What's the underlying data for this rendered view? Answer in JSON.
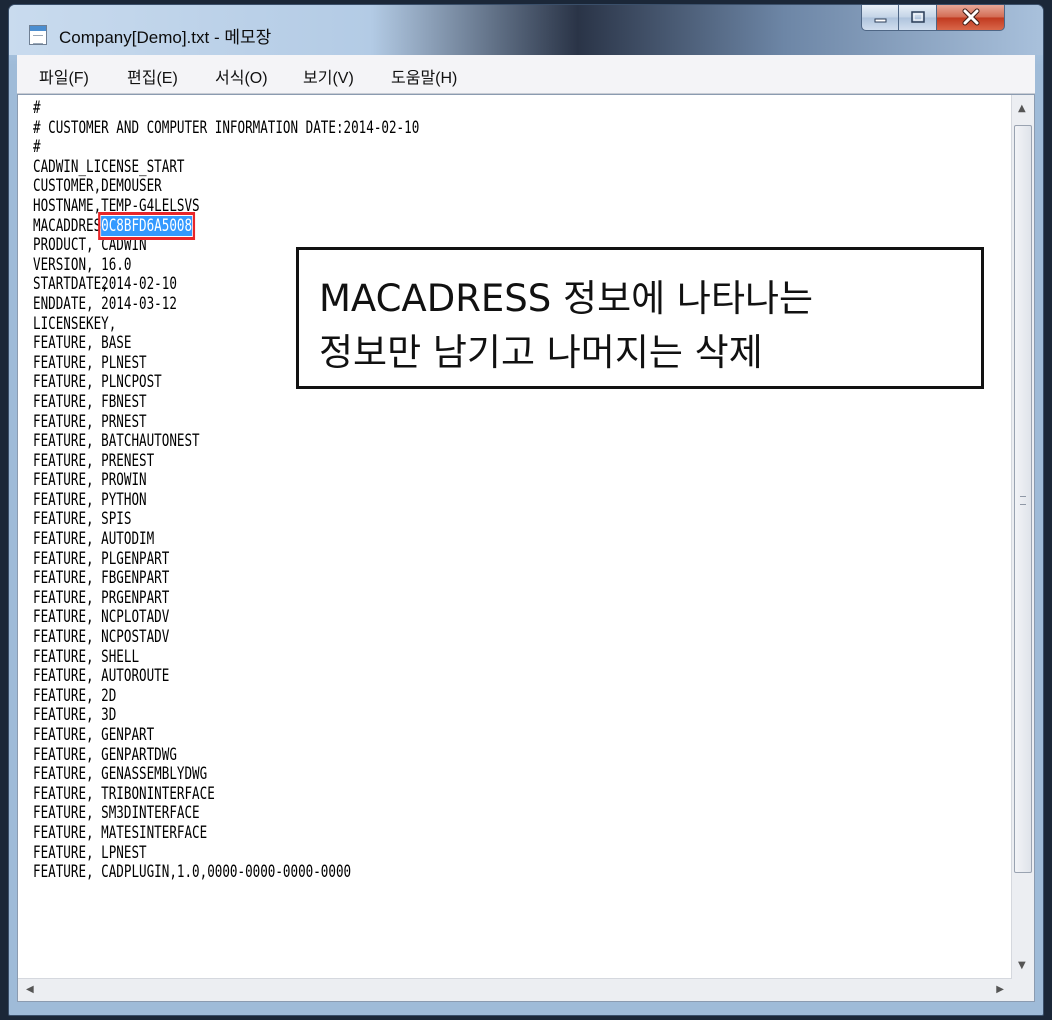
{
  "window": {
    "title": "Company[Demo].txt - 메모장"
  },
  "menu": [
    "파일(F)",
    "편집(E)",
    "서식(O)",
    "보기(V)",
    "도움말(H)"
  ],
  "document": {
    "lines": [
      {
        "k": "#",
        "v": ""
      },
      {
        "k": "# CUSTOMER AND COMPUTER INFORMATION DATE:2014-02-10",
        "v": ""
      },
      {
        "k": "#",
        "v": ""
      },
      {
        "k": "CADWIN_LICENSE_START",
        "v": ""
      },
      {
        "k": "CUSTOMER,",
        "v": "DEMOUSER"
      },
      {
        "k": "HOSTNAME,",
        "v": "TEMP-G4LELSVS"
      },
      {
        "k": "MACADDRESS,",
        "v": "0C8BFD6A5008",
        "sel": true
      },
      {
        "k": "PRODUCT,",
        "v": "CADWIN"
      },
      {
        "k": "VERSION,",
        "v": "16.0"
      },
      {
        "k": "STARTDATE,",
        "v": "2014-02-10"
      },
      {
        "k": "ENDDATE,",
        "v": "2014-03-12"
      },
      {
        "k": "LICENSEKEY,",
        "v": ""
      },
      {
        "k": "FEATURE,",
        "v": "BASE"
      },
      {
        "k": "FEATURE,",
        "v": "PLNEST"
      },
      {
        "k": "FEATURE,",
        "v": "PLNCPOST"
      },
      {
        "k": "FEATURE,",
        "v": "FBNEST"
      },
      {
        "k": "FEATURE,",
        "v": "PRNEST"
      },
      {
        "k": "FEATURE,",
        "v": "BATCHAUTONEST"
      },
      {
        "k": "FEATURE,",
        "v": "PRENEST"
      },
      {
        "k": "FEATURE,",
        "v": "PROWIN"
      },
      {
        "k": "FEATURE,",
        "v": "PYTHON"
      },
      {
        "k": "FEATURE,",
        "v": "SPIS"
      },
      {
        "k": "FEATURE,",
        "v": "AUTODIM"
      },
      {
        "k": "FEATURE,",
        "v": "PLGENPART"
      },
      {
        "k": "FEATURE,",
        "v": "FBGENPART"
      },
      {
        "k": "FEATURE,",
        "v": "PRGENPART"
      },
      {
        "k": "FEATURE,",
        "v": "NCPLOTADV"
      },
      {
        "k": "FEATURE,",
        "v": "NCPOSTADV"
      },
      {
        "k": "FEATURE,",
        "v": "SHELL"
      },
      {
        "k": "FEATURE,",
        "v": "AUTOROUTE"
      },
      {
        "k": "FEATURE,",
        "v": "2D"
      },
      {
        "k": "FEATURE,",
        "v": "3D"
      },
      {
        "k": "FEATURE,",
        "v": "GENPART"
      },
      {
        "k": "FEATURE,",
        "v": "GENPARTDWG"
      },
      {
        "k": "FEATURE,",
        "v": "GENASSEMBLYDWG"
      },
      {
        "k": "FEATURE,",
        "v": "TRIBONINTERFACE"
      },
      {
        "k": "FEATURE,",
        "v": "SM3DINTERFACE"
      },
      {
        "k": "FEATURE,",
        "v": "MATESINTERFACE"
      },
      {
        "k": "FEATURE,",
        "v": "LPNEST"
      },
      {
        "k": "FEATURE,",
        "v": "CADPLUGIN,1.0,0000-0000-0000-0000"
      }
    ]
  },
  "annotation": {
    "line1": "MACADRESS 정보에 나타나는",
    "line2": "정보만 남기고 나머지는 삭제"
  },
  "colors": {
    "selection": "#3399ff",
    "highlight_border": "#e8262a",
    "arrow": "#c0504d"
  },
  "icons": [
    "notepad-icon",
    "minimize-icon",
    "maximize-icon",
    "close-icon",
    "scroll-up-icon",
    "scroll-down-icon",
    "scroll-left-icon",
    "scroll-right-icon",
    "resize-grip-icon"
  ]
}
